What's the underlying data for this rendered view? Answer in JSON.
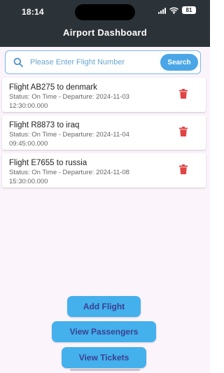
{
  "status_bar": {
    "time": "18:14",
    "battery": "81"
  },
  "header": {
    "title": "Airport Dashboard"
  },
  "search": {
    "placeholder": "Please Enter Flight Number",
    "value": "",
    "button_label": "Search"
  },
  "flights": [
    {
      "title": "Flight AB275 to denmark",
      "line1": "Status: On Time - Departure: 2024-11-03",
      "line2": "12:30:00.000"
    },
    {
      "title": "Flight R8873 to iraq",
      "line1": "Status: On Time - Departure: 2024-11-04",
      "line2": "09:45:00.000"
    },
    {
      "title": "Flight E7655 to russia",
      "line1": "Status: On Time - Departure: 2024-11-08",
      "line2": "15:30:00.000"
    }
  ],
  "actions": {
    "add_flight": "Add Flight",
    "view_passengers": "View Passengers",
    "view_tickets": "View Tickets"
  },
  "colors": {
    "header_bg": "#2c3338",
    "accent": "#4aa6e6",
    "delete": "#e04545",
    "page_bg": "#fbf4fb"
  },
  "icons": {
    "search": "search-icon",
    "delete": "trash-icon"
  }
}
